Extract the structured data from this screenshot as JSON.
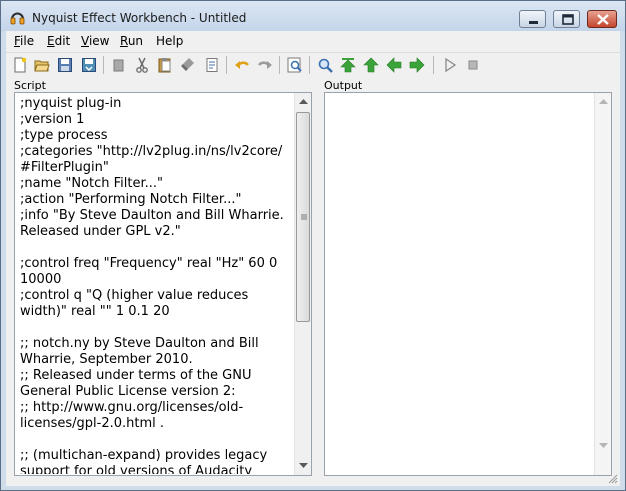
{
  "window": {
    "title": "Nyquist Effect Workbench - Untitled",
    "icon": "nyquist-headphones-icon",
    "caption_buttons": [
      "minimize-icon",
      "maximize-icon",
      "close-icon"
    ]
  },
  "menu": {
    "file": {
      "accel": "F",
      "rest": "ile"
    },
    "edit": {
      "accel": "E",
      "rest": "dit"
    },
    "view": {
      "accel": "V",
      "rest": "iew"
    },
    "run": {
      "accel": "R",
      "rest": "un"
    },
    "help": {
      "accel": "",
      "rest": "Help"
    }
  },
  "toolbar": [
    "new-icon",
    "open-icon",
    "save-icon",
    "save-as-icon",
    "copy-icon",
    "cut-icon",
    "paste-icon",
    "clear-icon",
    "select-all-icon",
    "undo-icon",
    "redo-icon",
    "find-icon",
    "match-icon",
    "top-icon",
    "up-icon",
    "previous-icon",
    "next-icon",
    "go-icon",
    "stop-icon"
  ],
  "panels": {
    "script_label": "Script",
    "output_label": "Output"
  },
  "script_lines": [
    ";nyquist plug-in",
    ";version 1",
    ";type process",
    ";categories \"http://lv2plug.in/ns/lv2core/",
    "#FilterPlugin\"",
    ";name \"Notch Filter...\"",
    ";action \"Performing Notch Filter...\"",
    ";info \"By Steve Daulton and Bill Wharrie.",
    "Released under GPL v2.\"",
    "",
    ";control freq \"Frequency\" real \"Hz\" 60 0",
    "10000",
    ";control q \"Q (higher value reduces",
    "width)\" real \"\" 1 0.1 20",
    "",
    ";; notch.ny by Steve Daulton and Bill",
    "Wharrie, September 2010.",
    ";; Released under terms of the GNU",
    "General Public License version 2:",
    ";; http://www.gnu.org/licenses/old-",
    "licenses/gpl-2.0.html .",
    "",
    ";; (multichan-expand) provides legacy",
    "support for old versions of Audacity"
  ],
  "output_text": "",
  "colors": {
    "accent_green": "#3aa43a",
    "title_bar": "#c4d5ea",
    "close_red": "#c4452d"
  }
}
